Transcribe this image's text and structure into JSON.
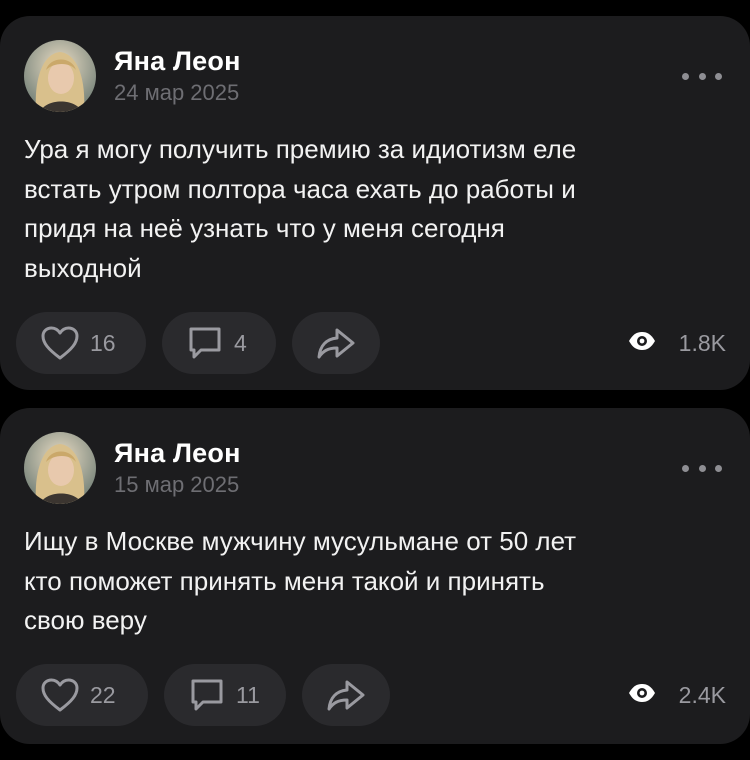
{
  "posts": [
    {
      "author": "Яна Леон",
      "date": "24 мар 2025",
      "text": "Ура я могу получить премию за идиотизм еле\nвстать утром полтора часа ехать до работы и\nпридя на неё узнать что у меня сегодня\nвыходной",
      "likes": "16",
      "comments": "4",
      "views": "1.8K"
    },
    {
      "author": "Яна Леон",
      "date": "15 мар 2025",
      "text": "Ищу в Москве мужчину мусульмане от 50 лет\nкто поможет принять меня такой и принять\nсвою веру",
      "likes": "22",
      "comments": "11",
      "views": "2.4K"
    }
  ],
  "icons": {
    "like": "heart-icon",
    "comment": "comment-icon",
    "share": "share-icon",
    "views": "eye-icon",
    "more": "more-icon"
  },
  "colors": {
    "background": "#000000",
    "card": "#1c1c1e",
    "pill": "#2a2a2d",
    "muted": "#8e8e93"
  }
}
